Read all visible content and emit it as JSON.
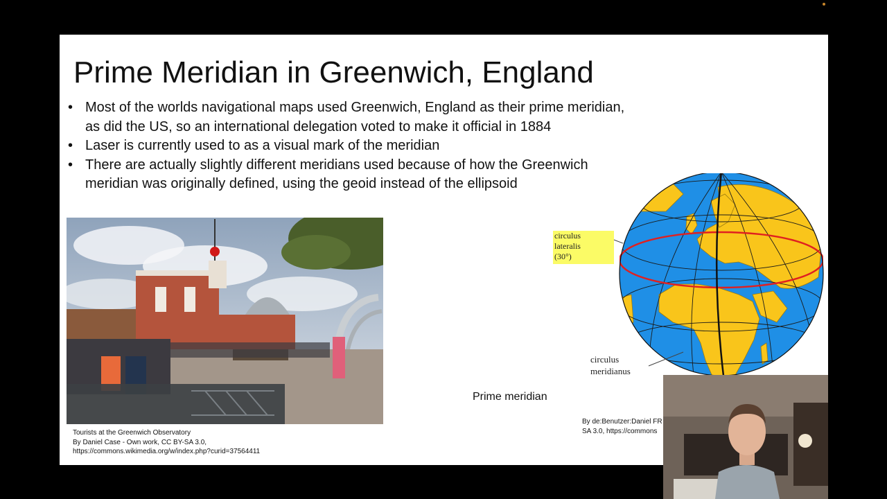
{
  "slide": {
    "title": "Prime Meridian in Greenwich, England",
    "bullets": [
      "Most of the worlds navigational maps used Greenwich, England as their prime meridian, as did the US, so an international delegation voted to make it official in 1884",
      "Laser is currently used to as a visual mark of the meridian",
      "There are actually slightly different meridians used because of how the Greenwich meridian was originally defined, using the geoid instead of the ellipsoid"
    ],
    "photo_caption": {
      "line1": "Tourists at the Greenwich Observatory",
      "line2": "By Daniel Case - Own work, CC BY-SA 3.0,",
      "line3": "https://commons.wikimedia.org/w/index.php?curid=37564411"
    },
    "globe": {
      "label_lateralis_1": "circulus",
      "label_lateralis_2": "lateralis",
      "label_lateralis_3": "(30°)",
      "label_meridianus_1": "circulus",
      "label_meridianus_2": "meridianus"
    },
    "prime_meridian_label": "Prime meridian",
    "globe_credit": {
      "line1": "By de:Benutzer:Daniel FR",
      "line2": "SA 3.0, https://commons"
    }
  },
  "colors": {
    "ocean": "#1f8fe6",
    "land": "#f9c51b",
    "latitude_line": "#e02020",
    "label_box": "#fbfb66"
  }
}
